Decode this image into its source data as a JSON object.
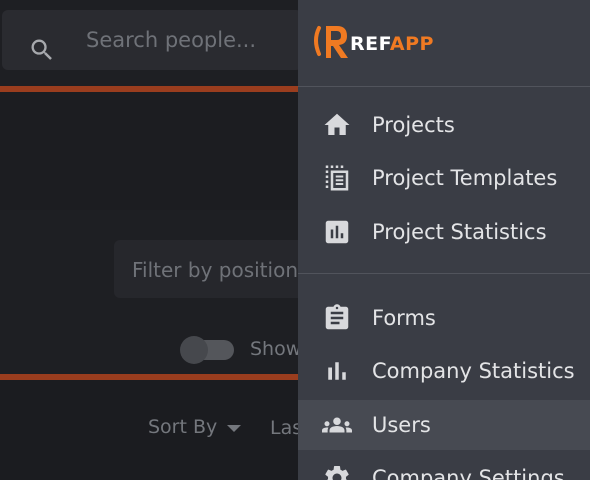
{
  "background": {
    "search": {
      "placeholder": "Search people..."
    },
    "filter": {
      "placeholder": "Filter by position"
    },
    "toggle_label": "Show",
    "sort_by_label": "Sort By",
    "last_label": "Las"
  },
  "drawer": {
    "logo": {
      "part1": "REF",
      "part2": "APP",
      "accent_color": "#f07a22"
    },
    "groups": [
      {
        "items": [
          {
            "label": "Projects",
            "icon": "home-icon"
          },
          {
            "label": "Project Templates",
            "icon": "template-list-icon"
          },
          {
            "label": "Project Statistics",
            "icon": "stats-box-icon"
          }
        ]
      },
      {
        "items": [
          {
            "label": "Forms",
            "icon": "clipboard-icon"
          },
          {
            "label": "Company Statistics",
            "icon": "bar-chart-icon"
          },
          {
            "label": "Users",
            "icon": "people-icon",
            "active": true
          },
          {
            "label": "Company Settings",
            "icon": "gear-icon"
          }
        ]
      }
    ]
  }
}
